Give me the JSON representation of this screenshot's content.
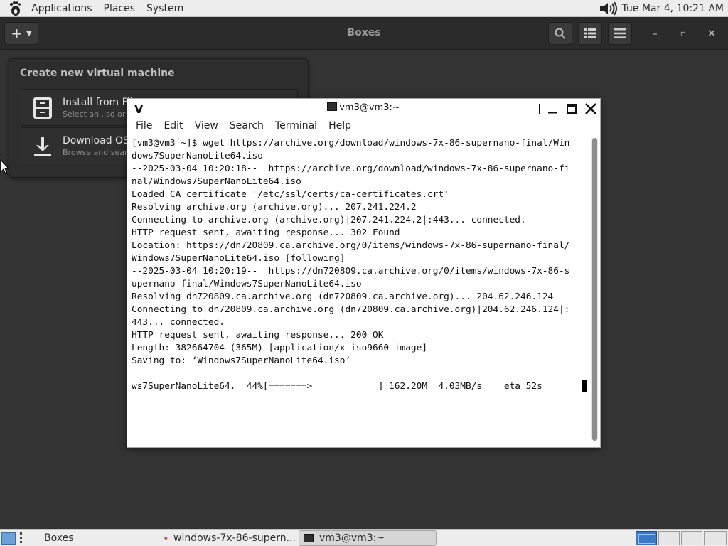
{
  "top_panel": {
    "menus": [
      "Applications",
      "Places",
      "System"
    ],
    "clock": "Tue Mar  4, 10:21 AM"
  },
  "boxes": {
    "title": "Boxes",
    "new_button": "+",
    "popover": {
      "title": "Create new virtual machine",
      "items": [
        {
          "title": "Install from File",
          "subtitle": "Select an .iso or .img file"
        },
        {
          "title": "Download OS",
          "subtitle": "Browse and search for operating systems to install"
        }
      ]
    }
  },
  "terminal": {
    "logo": "V",
    "title": "vm3@vm3:~",
    "menus": [
      "File",
      "Edit",
      "View",
      "Search",
      "Terminal",
      "Help"
    ],
    "lines": [
      "[vm3@vm3 ~]$ wget https://archive.org/download/windows-7x-86-supernano-final/Win",
      "dows7SuperNanoLite64.iso",
      "--2025-03-04 10:20:18--  https://archive.org/download/windows-7x-86-supernano-fi",
      "nal/Windows7SuperNanoLite64.iso",
      "Loaded CA certificate '/etc/ssl/certs/ca-certificates.crt'",
      "Resolving archive.org (archive.org)... 207.241.224.2",
      "Connecting to archive.org (archive.org)|207.241.224.2|:443... connected.",
      "HTTP request sent, awaiting response... 302 Found",
      "Location: https://dn720809.ca.archive.org/0/items/windows-7x-86-supernano-final/",
      "Windows7SuperNanoLite64.iso [following]",
      "--2025-03-04 10:20:19--  https://dn720809.ca.archive.org/0/items/windows-7x-86-s",
      "upernano-final/Windows7SuperNanoLite64.iso",
      "Resolving dn720809.ca.archive.org (dn720809.ca.archive.org)... 204.62.246.124",
      "Connecting to dn720809.ca.archive.org (dn720809.ca.archive.org)|204.62.246.124|:",
      "443... connected.",
      "HTTP request sent, awaiting response... 200 OK",
      "Length: 382664704 (365M) [application/x-iso9660-image]",
      "Saving to: ‘Windows7SuperNanoLite64.iso’",
      "",
      "ws7SuperNanoLite64.  44%[=======>            ] 162.20M  4.03MB/s    eta 52s"
    ]
  },
  "taskbar": {
    "items": [
      {
        "label": "Boxes"
      },
      {
        "label": "windows-7x-86-supern..."
      },
      {
        "label": "vm3@vm3:~"
      }
    ]
  }
}
